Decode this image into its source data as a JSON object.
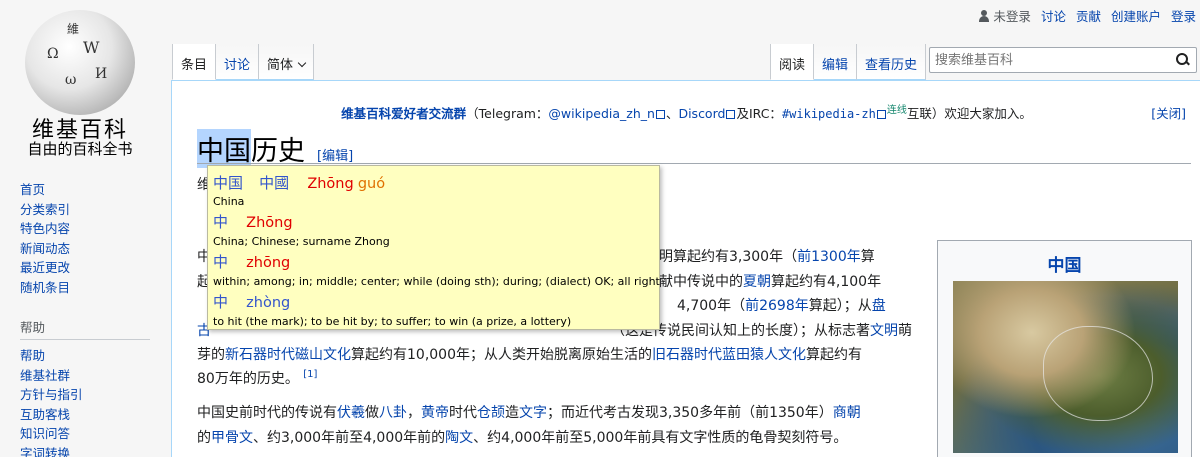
{
  "logo": {
    "title": "维基百科",
    "subtitle": "自由的百科全书",
    "glyphs": [
      "Ω",
      "W",
      "維",
      "И",
      "ω"
    ]
  },
  "personal": {
    "not_logged_in": "未登录",
    "talk": "讨论",
    "contributions": "贡献",
    "create_account": "创建账户",
    "login": "登录"
  },
  "tabs": {
    "article": "条目",
    "talk": "讨论",
    "variant": "简体",
    "read": "阅读",
    "edit": "编辑",
    "history": "查看历史"
  },
  "search": {
    "placeholder": "搜索维基百科"
  },
  "sidebar": {
    "nav": [
      "首页",
      "分类索引",
      "特色内容",
      "新闻动态",
      "最近更改",
      "随机条目"
    ],
    "help_heading": "帮助",
    "help": [
      "帮助",
      "维基社群",
      "方针与指引",
      "互助客栈",
      "知识问答",
      "字词转换"
    ]
  },
  "notice": {
    "group": "维基百科爱好者交流群",
    "p1": "（Telegram：",
    "tg": "@wikipedia_zh_n",
    "sep1": "、",
    "discord": "Discord",
    "irc_pre": "及IRC：",
    "irc": "#wikipedia-zh",
    "irc_sup": "连线",
    "p2": "互联）欢迎大家加入。",
    "close": "[关闭]"
  },
  "page": {
    "title_hl": "中国",
    "title_rest": "历史",
    "edit_link": "[编辑]"
  },
  "body": {
    "l0": "维",
    "l1a": "中",
    "l1b": "明算起约有3,300年（",
    "l1c": "前1300年",
    "l1d": "算",
    "l2a": "起",
    "l2b": "献中传说中的",
    "l2c": "夏朝",
    "l2d": "算起约有4,100年",
    "l3a": "4,700年（",
    "l3b": "前2698年",
    "l3c": "算起）；从",
    "l3d": "盘",
    "l4a": "古",
    "l4b": "（这是传说民间认知上的长度）；从标志著",
    "l4c": "文明",
    "l4d": "萌",
    "l5a": "芽的",
    "l5b": "新石器时代磁山文化",
    "l5c": "算起约有10,000年；从人类开始脱离原始生活的",
    "l5d": "旧石器时代蓝田猿人文化",
    "l5e": "算起约有",
    "l6a": "80万年的历史。",
    "l6ref": "[1]",
    "p2a": "中国史前时代的传说有",
    "p2b": "伏羲",
    "p2c": "做",
    "p2d": "八卦",
    "p2e": "，",
    "p2f": "黄帝",
    "p2g": "时代",
    "p2h": "仓颉",
    "p2i": "造",
    "p2j": "文字",
    "p2k": "；而近代考古发现3,350多年前（前1350年）",
    "p2l": "商朝",
    "p3a": "的",
    "p3b": "甲骨文",
    "p3c": "、约3,000年前至4,000年前的",
    "p3d": "陶文",
    "p3e": "、约4,000年前至5,000年前具有文字性质的龟骨契刻符号。"
  },
  "infobox": {
    "title": "中国"
  },
  "popup": {
    "entries": [
      {
        "simp": "中国",
        "trad": "中國",
        "py1": "Zhōng",
        "py2": "guó",
        "def": "China"
      },
      {
        "simp": "中",
        "py1": "Zhōng",
        "def": "China; Chinese; surname Zhong"
      },
      {
        "simp": "中",
        "py1": "zhōng",
        "def": "within; among; in; middle; center; while (doing sth); during; (dialect) OK; all right"
      },
      {
        "simp": "中",
        "py1": "zhòng",
        "def": "to hit (the mark); to be hit by; to suffer; to win (a prize, a lottery)"
      }
    ]
  },
  "colors": {
    "link": "#0645ad",
    "popup_bg": "#ffffc0",
    "tone1": "#e00000",
    "tone2": "#e07000",
    "tone4": "#3355cc"
  }
}
